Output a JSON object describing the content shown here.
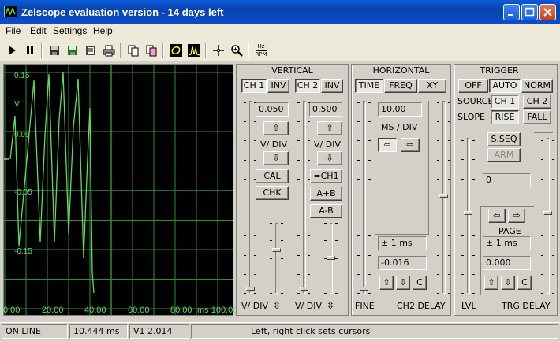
{
  "window": {
    "title": "Zelscope evaluation version - 14 days left"
  },
  "menu": [
    "File",
    "Edit",
    "Settings",
    "Help"
  ],
  "toolbar": {
    "hz_label_top": "Hz",
    "hz_label_bottom": "RPM"
  },
  "scope": {
    "y_ticks": [
      "0.15",
      "0.05",
      "-0.05",
      "-0.15"
    ],
    "y_unit": "V",
    "x_ticks": [
      "0.00",
      "20.00",
      "40.00",
      "60.00",
      "80.00",
      "ms 100.00"
    ],
    "trace_color": "#5fdc5f",
    "grid_color": "#2f8f2f"
  },
  "vertical": {
    "title": "VERTICAL",
    "ch1": {
      "label": "CH 1",
      "inv": "INV",
      "value": "0.050",
      "vdiv": "V/ DIV",
      "cal": "CAL",
      "chk": "CHK",
      "foot": "V/ DIV"
    },
    "ch2": {
      "label": "CH 2",
      "inv": "INV",
      "value": "0.500",
      "vdiv": "V/ DIV",
      "eq_ch1": "=CH1",
      "a_plus_b": "A+B",
      "a_minus_b": "A-B",
      "foot": "V/ DIV"
    }
  },
  "horizontal": {
    "title": "HORIZONTAL",
    "tabs": [
      "TIME",
      "FREQ",
      "XY"
    ],
    "value": "10.00",
    "msdiv": "MS / DIV",
    "cursor_delta": "± 1 ms",
    "ch2_delay_value": "-0.016",
    "c_label": "C",
    "fine": "FINE",
    "ch2_delay": "CH2 DELAY"
  },
  "trigger": {
    "title": "TRIGGER",
    "modes": [
      "OFF",
      "AUTO",
      "NORM"
    ],
    "source_label": "SOURCE",
    "sources": [
      "CH 1",
      "CH 2"
    ],
    "slope_label": "SLOPE",
    "slopes": [
      "RISE",
      "FALL"
    ],
    "sseq": "S.SEQ",
    "arm": "ARM",
    "level_value": "0",
    "page": "PAGE",
    "delay_delta": "± 1 ms",
    "delay_value": "0.000",
    "c_label": "C",
    "lvl": "LVL",
    "trg_delay": "TRG DELAY"
  },
  "status": {
    "state": "ON LINE",
    "time": "10.444 ms",
    "version": "V1 2.014",
    "hint": "Left, right click sets cursors"
  }
}
